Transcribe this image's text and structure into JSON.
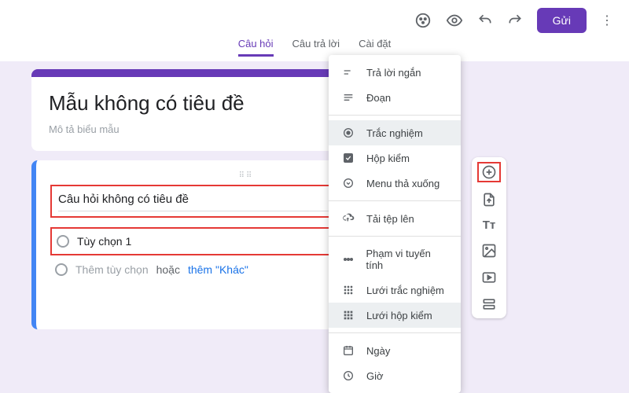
{
  "header": {
    "send_label": "Gửi"
  },
  "tabs": {
    "questions": "Câu hỏi",
    "responses": "Câu trả lời",
    "settings": "Cài đặt"
  },
  "form": {
    "title": "Mẫu không có tiêu đề",
    "description_placeholder": "Mô tả biểu mẫu"
  },
  "question": {
    "title": "Câu hỏi không có tiêu đề",
    "option1": "Tùy chọn 1",
    "add_option": "Thêm tùy chọn",
    "or": "hoặc",
    "add_other": "thêm \"Khác\""
  },
  "type_menu": {
    "short_answer": "Trả lời ngắn",
    "paragraph": "Đoạn",
    "multiple_choice": "Trắc nghiệm",
    "checkboxes": "Hộp kiểm",
    "dropdown": "Menu thả xuống",
    "file_upload": "Tải tệp lên",
    "linear_scale": "Phạm vi tuyến tính",
    "mc_grid": "Lưới trắc nghiệm",
    "checkbox_grid": "Lưới hộp kiểm",
    "date": "Ngày",
    "time": "Giờ"
  }
}
